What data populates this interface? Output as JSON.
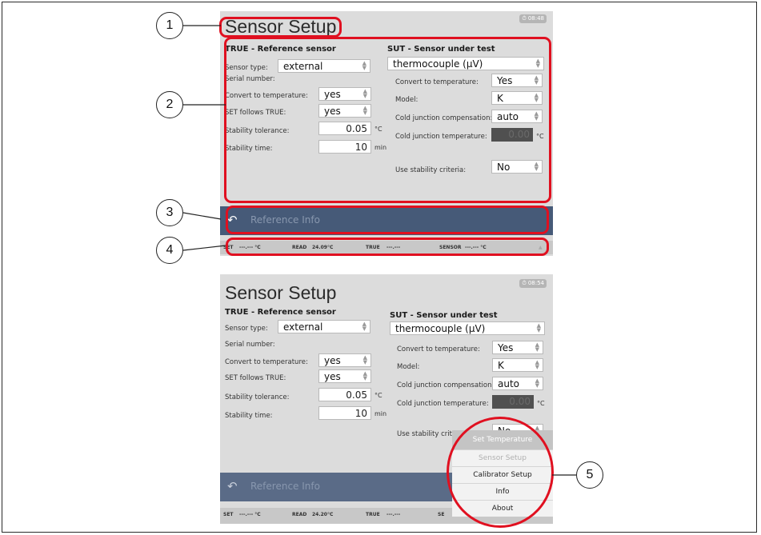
{
  "title": "Sensor Setup",
  "clock_top": "08:48",
  "clock_bottom": "08:54",
  "true_panel": {
    "heading": "TRUE - Reference sensor",
    "sensor_type_label": "Sensor type:",
    "sensor_type_value": "external",
    "serial_label": "Serial number:",
    "convert_label": "Convert to temperature:",
    "convert_value": "yes",
    "set_follows_label": "SET follows TRUE:",
    "set_follows_value": "yes",
    "tolerance_label": "Stability tolerance:",
    "tolerance_value": "0.05",
    "tolerance_unit": "°C",
    "time_label": "Stability time:",
    "time_value": "10",
    "time_unit": "min"
  },
  "sut_panel": {
    "heading": "SUT - Sensor under test",
    "sensor_value": "thermocouple (µV)",
    "convert_label": "Convert to temperature:",
    "convert_value": "Yes",
    "model_label": "Model:",
    "model_value": "K",
    "cjc_label": "Cold junction compensation:",
    "cjc_value": "auto",
    "cjt_label": "Cold junction temperature:",
    "cjt_value_top": "0.00",
    "cjt_value_bottom": "0.00",
    "cjt_unit": "°C",
    "stability_label": "Use stability criteria:",
    "stability_value": "No"
  },
  "bottom_bar": {
    "label": "Reference Info"
  },
  "status_top": {
    "set": "SET",
    "set_val": "---.--- °C",
    "read": "READ",
    "read_val": "24.09°C",
    "true": "TRUE",
    "true_val": "---.---",
    "sensor": "SENSOR",
    "sensor_val": "---.--- °C"
  },
  "status_bottom": {
    "set": "SET",
    "set_val": "---.--- °C",
    "read": "READ",
    "read_val": "24.20°C",
    "true": "TRUE",
    "true_val": "---.---",
    "sensor": "SE"
  },
  "menu": {
    "header": "Set Temperature",
    "items": [
      "Sensor Setup",
      "Calibrator Setup",
      "Info",
      "About"
    ]
  },
  "callouts": [
    "1",
    "2",
    "3",
    "4",
    "5"
  ]
}
